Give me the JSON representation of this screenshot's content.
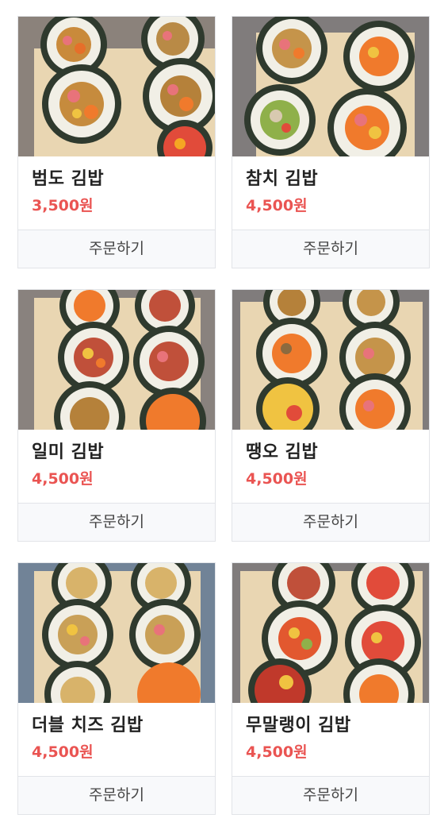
{
  "products": [
    {
      "name": "범도 김밥",
      "price": "3,500원",
      "order_label": "주문하기",
      "image": "gimbap-photo"
    },
    {
      "name": "참치 김밥",
      "price": "4,500원",
      "order_label": "주문하기",
      "image": "gimbap-photo"
    },
    {
      "name": "일미 김밥",
      "price": "4,500원",
      "order_label": "주문하기",
      "image": "gimbap-photo"
    },
    {
      "name": "땡오 김밥",
      "price": "4,500원",
      "order_label": "주문하기",
      "image": "gimbap-photo"
    },
    {
      "name": "더블 치즈 김밥",
      "price": "4,500원",
      "order_label": "주문하기",
      "image": "gimbap-photo"
    },
    {
      "name": "무말랭이 김밥",
      "price": "4,500원",
      "order_label": "주문하기",
      "image": "gimbap-photo"
    }
  ],
  "colors": {
    "price": "#ea5452",
    "name": "#222222",
    "button_bg": "#f8f9fb",
    "border": "#e2e4e8"
  }
}
